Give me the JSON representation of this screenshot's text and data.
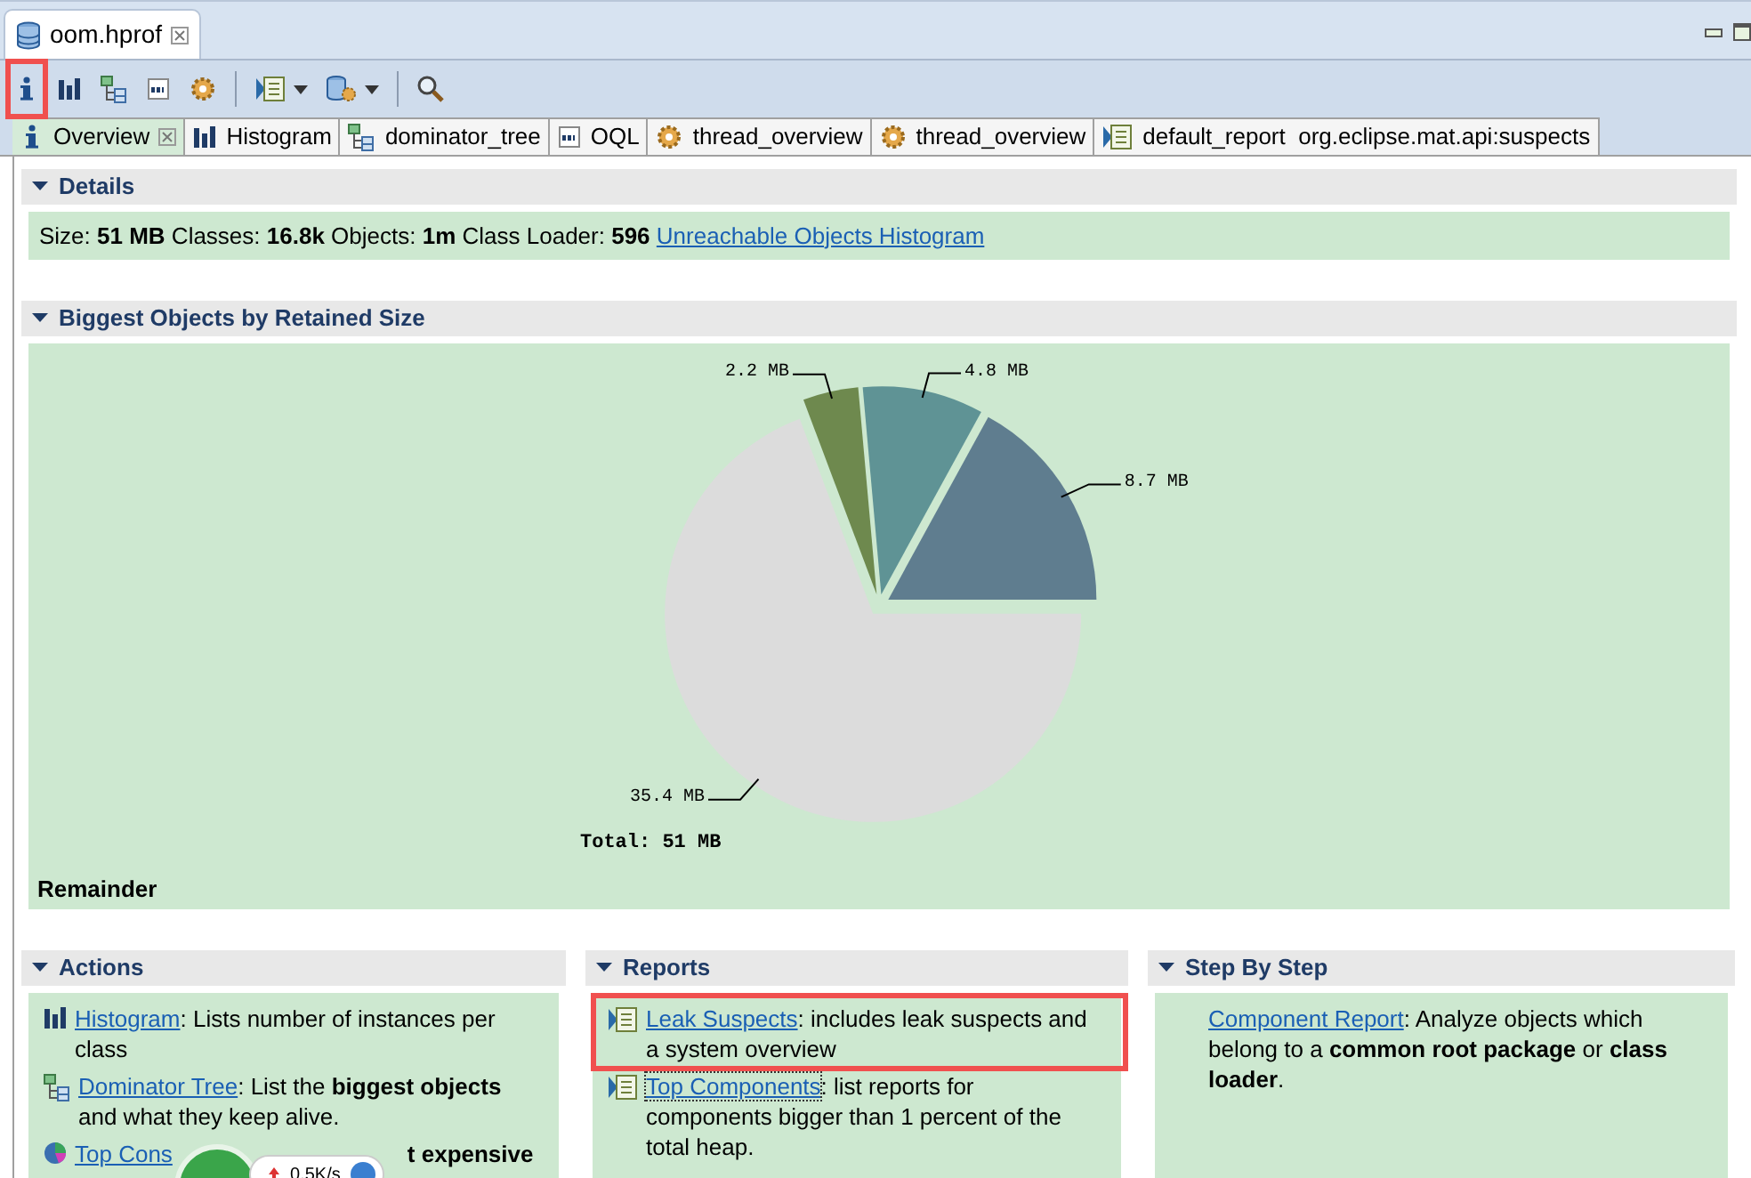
{
  "editor_tab": {
    "title": "oom.hprof",
    "selected": true
  },
  "toolbar": [
    {
      "kind": "info",
      "highlighted": true,
      "dropdown": false
    },
    {
      "kind": "bars",
      "highlighted": false,
      "dropdown": false
    },
    {
      "kind": "tree",
      "highlighted": false,
      "dropdown": false
    },
    {
      "kind": "oql",
      "highlighted": false,
      "dropdown": false
    },
    {
      "kind": "gear",
      "highlighted": false,
      "dropdown": false
    },
    {
      "kind": "separator"
    },
    {
      "kind": "report",
      "highlighted": false,
      "dropdown": true
    },
    {
      "kind": "dbgear",
      "highlighted": false,
      "dropdown": true
    },
    {
      "kind": "separator"
    },
    {
      "kind": "search",
      "highlighted": false,
      "dropdown": false
    }
  ],
  "tabs": [
    {
      "kind": "info",
      "label": "Overview",
      "selected": true,
      "closable": true
    },
    {
      "kind": "bars",
      "label": "Histogram",
      "selected": false,
      "closable": false
    },
    {
      "kind": "tree",
      "label": "dominator_tree",
      "selected": false,
      "closable": false
    },
    {
      "kind": "oql",
      "label": "OQL",
      "selected": false,
      "closable": false
    },
    {
      "kind": "gear",
      "label": "thread_overview",
      "selected": false,
      "closable": false
    },
    {
      "kind": "gear",
      "label": "thread_overview",
      "selected": false,
      "closable": false
    },
    {
      "kind": "report",
      "label": "default_report  org.eclipse.mat.api:suspects",
      "selected": false,
      "closable": false
    }
  ],
  "details": {
    "title": "Details",
    "expanded": true,
    "text": "Size: **51 MB** Classes: **16.8k** Objects: **1m** Class Loader: **596**",
    "link": "Unreachable Objects Histogram"
  },
  "biggest_objects": {
    "title": "Biggest Objects by Retained Size",
    "expanded": true,
    "chart_data": {
      "type": "pie",
      "values": [
        8.7,
        4.8,
        2.2,
        35.4
      ],
      "value_labels": [
        "8.7 MB",
        "4.8 MB",
        "2.2 MB",
        "35.4 MB"
      ],
      "colors": [
        "#5f7d8f",
        "#5f9395",
        "#6e894e",
        "#dcdcdc"
      ]
    },
    "total": "Total: 51 MB",
    "footer": "Remainder"
  },
  "columns": [
    {
      "title": "Actions",
      "expanded": true,
      "items": [
        {
          "kind": "bars",
          "link": "Histogram",
          "text": ": Lists number of instances per class",
          "highlighted": false,
          "focused": false
        },
        {
          "kind": "tree",
          "link": "Dominator Tree",
          "text": ": List the **biggest objects** and what they keep alive.",
          "highlighted": false,
          "focused": false
        },
        {
          "kind": "pie",
          "link": "Top Cons",
          "tail": "t expensive",
          "highlighted": false,
          "focused": false
        }
      ]
    },
    {
      "title": "Reports",
      "expanded": true,
      "items": [
        {
          "kind": "report",
          "link": "Leak Suspects",
          "text": ": includes leak suspects and a system overview",
          "highlighted": true,
          "focused": false
        },
        {
          "kind": "report",
          "link": "Top Components",
          "text": ": list reports for components bigger than 1 percent of the total heap.",
          "highlighted": false,
          "focused": true
        }
      ]
    },
    {
      "title": "Step By Step",
      "expanded": true,
      "items": [
        {
          "kind": "none",
          "link": "Component Report",
          "text": ": Analyze objects which belong to a **common root package** or **class loader**.",
          "highlighted": false,
          "focused": false
        }
      ]
    }
  ],
  "overlay_widget": {
    "speed": "0.5K/s"
  }
}
